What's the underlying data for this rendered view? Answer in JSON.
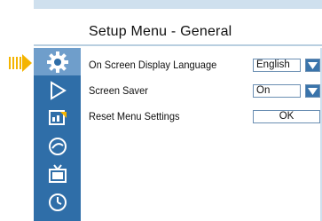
{
  "header": {
    "title": "Setup Menu - General"
  },
  "sidebar": {
    "items": [
      {
        "icon": "gear-icon",
        "active": true
      },
      {
        "icon": "play-icon",
        "active": false
      },
      {
        "icon": "picture-settings-icon",
        "active": false
      },
      {
        "icon": "audio-disc-icon",
        "active": false
      },
      {
        "icon": "tv-icon",
        "active": false
      },
      {
        "icon": "clock-icon",
        "active": false
      }
    ]
  },
  "settings": {
    "osd_language": {
      "label": "On Screen Display Language",
      "value": "English"
    },
    "screen_saver": {
      "label": "Screen Saver",
      "value": "On"
    },
    "reset": {
      "label": "Reset Menu Settings",
      "button": "OK"
    }
  },
  "colors": {
    "accent": "#2f6ea8",
    "highlight": "#6f9ecb",
    "pointer": "#f4b400"
  }
}
